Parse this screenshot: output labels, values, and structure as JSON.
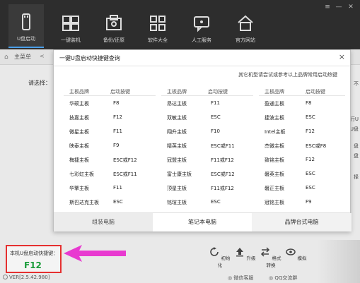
{
  "toolbar": {
    "items": [
      {
        "label": "U盘启动",
        "icon": "usb-icon"
      },
      {
        "label": "一键装机",
        "icon": "windows-icon"
      },
      {
        "label": "备份/还原",
        "icon": "backup-icon"
      },
      {
        "label": "软件大全",
        "icon": "apps-grid-icon"
      },
      {
        "label": "人工服务",
        "icon": "service-icon"
      },
      {
        "label": "官方网站",
        "icon": "home-icon"
      }
    ],
    "window_controls": [
      "≡",
      "—",
      "✕"
    ]
  },
  "breadcrumb": {
    "label": "主菜单",
    "sep": "<"
  },
  "left_label": "请选择：",
  "popup": {
    "title": "一键U盘启动快捷键查询",
    "close": "×",
    "note": "其它机型请尝试或参考以上品牌常用启动热键",
    "header_brand": "主板品牌",
    "header_key": "启动按键",
    "col1": [
      {
        "brand": "华硕主板",
        "key": "F8"
      },
      {
        "brand": "技嘉主板",
        "key": "F12"
      },
      {
        "brand": "微星主板",
        "key": "F11"
      },
      {
        "brand": "映泰主板",
        "key": "F9"
      },
      {
        "brand": "梅捷主板",
        "key": "ESC或F12"
      },
      {
        "brand": "七彩虹主板",
        "key": "ESC或F11"
      },
      {
        "brand": "华擎主板",
        "key": "F11"
      },
      {
        "brand": "斯巴达克主板",
        "key": "ESC"
      }
    ],
    "col2": [
      {
        "brand": "昂达主板",
        "key": "F11"
      },
      {
        "brand": "双敏主板",
        "key": "ESC"
      },
      {
        "brand": "翔升主板",
        "key": "F10"
      },
      {
        "brand": "精英主板",
        "key": "ESC或F11"
      },
      {
        "brand": "冠盟主板",
        "key": "F11或F12"
      },
      {
        "brand": "富士康主板",
        "key": "ESC或F12"
      },
      {
        "brand": "顶星主板",
        "key": "F11或F12"
      },
      {
        "brand": "铭瑄主板",
        "key": "ESC"
      }
    ],
    "col3": [
      {
        "brand": "盈通主板",
        "key": "F8"
      },
      {
        "brand": "捷波主板",
        "key": "ESC"
      },
      {
        "brand": "Intel主板",
        "key": "F12"
      },
      {
        "brand": "杰微主板",
        "key": "ESC或F8"
      },
      {
        "brand": "致铭主板",
        "key": "F12"
      },
      {
        "brand": "磐英主板",
        "key": "ESC"
      },
      {
        "brand": "磐正主板",
        "key": "ESC"
      },
      {
        "brand": "冠铭主板",
        "key": "F9"
      }
    ],
    "tabs": [
      "组装电脑",
      "笔记本电脑",
      "品牌台式电脑"
    ]
  },
  "hotkey": {
    "label": "本机U盘启动快捷键：",
    "value": "F12"
  },
  "bottom_tools": [
    {
      "label": "初始化",
      "icon": "reset-icon"
    },
    {
      "label": "升级",
      "icon": "upload-icon"
    },
    {
      "label": "格式转换",
      "icon": "convert-icon"
    },
    {
      "label": "模拟",
      "icon": "eye-icon"
    }
  ],
  "footer": {
    "version": "VER[2.5.42.980]",
    "wechat": "微信客服",
    "qq": "QQ交流群"
  },
  "side_letters": [
    "不",
    "行U",
    "U盘",
    "盘",
    "盘",
    "择"
  ],
  "colors": {
    "accent": "#4a9ee8",
    "highlight_red": "#e53030",
    "hotkey_green": "#1a9c3a",
    "arrow_magenta": "#e83ad0"
  }
}
